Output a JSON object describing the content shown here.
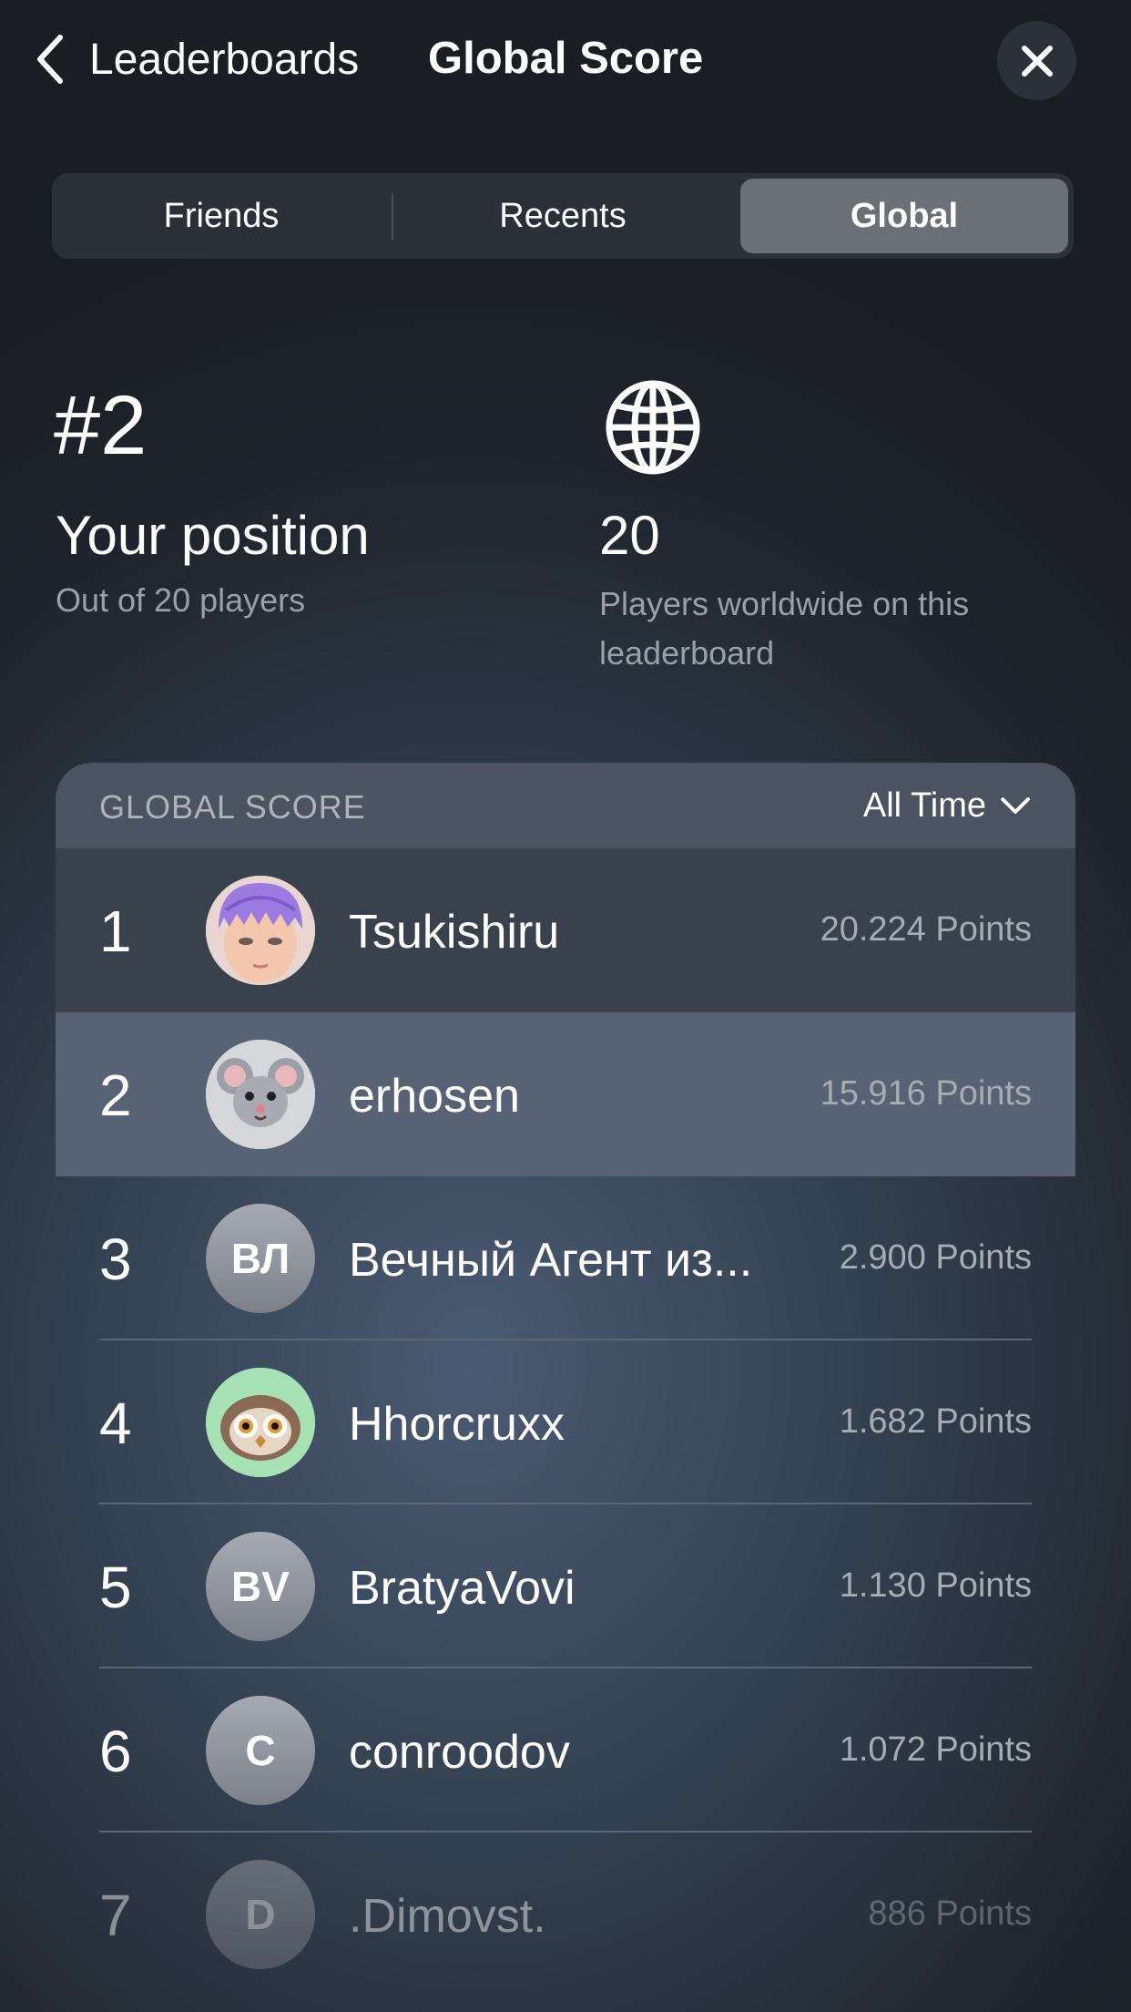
{
  "nav": {
    "back_label": "Leaderboards",
    "title": "Global Score"
  },
  "tabs": [
    {
      "label": "Friends",
      "selected": false
    },
    {
      "label": "Recents",
      "selected": false
    },
    {
      "label": "Global",
      "selected": true
    }
  ],
  "stats": {
    "rank": "#2",
    "rank_label": "Your position",
    "rank_sub": "Out of 20 players",
    "count": "20",
    "count_sub": "Players worldwide on this leaderboard"
  },
  "board": {
    "title": "GLOBAL SCORE",
    "period": "All Time",
    "rows": [
      {
        "rank": "1",
        "name": "Tsukishiru",
        "points": "20.224 Points",
        "avatar": "memoji-purple-hair"
      },
      {
        "rank": "2",
        "name": "erhosen",
        "points": "15.916 Points",
        "avatar": "mouse"
      },
      {
        "rank": "3",
        "name": "Вечный Агент из...",
        "points": "2.900 Points",
        "initials": "ВЛ"
      },
      {
        "rank": "4",
        "name": "Hhorcruxx",
        "points": "1.682 Points",
        "avatar": "owl"
      },
      {
        "rank": "5",
        "name": "BratyaVovi",
        "points": "1.130 Points",
        "initials": "BV"
      },
      {
        "rank": "6",
        "name": "conroodov",
        "points": "1.072 Points",
        "initials": "C"
      },
      {
        "rank": "7",
        "name": ".Dimovst.",
        "points": "886 Points",
        "initials": "D"
      }
    ]
  },
  "colors": {
    "highlight_row": "#5a6577",
    "selected_tab": "#6b6f76"
  }
}
